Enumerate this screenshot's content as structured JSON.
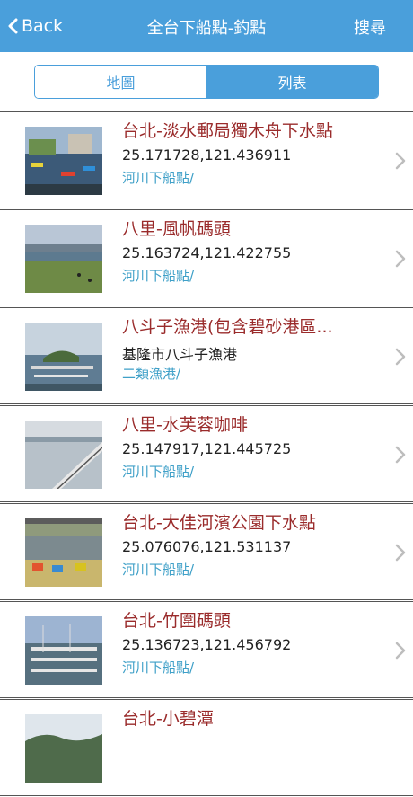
{
  "nav": {
    "back_label": "Back",
    "title": "全台下船點-釣點",
    "search_label": "搜尋"
  },
  "tabs": [
    {
      "label": "地圖",
      "active": false
    },
    {
      "label": "列表",
      "active": true
    }
  ],
  "colors": {
    "accent": "#4a9fdb",
    "title": "#9a2b2b",
    "category": "#3fa0c8"
  },
  "items": [
    {
      "title": "台北-淡水郵局獨木舟下水點",
      "subtitle": "25.171728,121.436911",
      "category": "河川下船點/"
    },
    {
      "title": "八里-風帆碼頭",
      "subtitle": "25.163724,121.422755",
      "category": "河川下船點/"
    },
    {
      "title": "八斗子漁港(包含碧砂港區...",
      "subtitle": "基隆市八斗子漁港",
      "category": "二類漁港/"
    },
    {
      "title": "八里-水芙蓉咖啡",
      "subtitle": "25.147917,121.445725",
      "category": "河川下船點/"
    },
    {
      "title": "台北-大佳河濱公園下水點",
      "subtitle": "25.076076,121.531137",
      "category": "河川下船點/"
    },
    {
      "title": "台北-竹圍碼頭",
      "subtitle": "25.136723,121.456792",
      "category": "河川下船點/"
    },
    {
      "title": "台北-小碧潭",
      "subtitle": "",
      "category": ""
    }
  ]
}
